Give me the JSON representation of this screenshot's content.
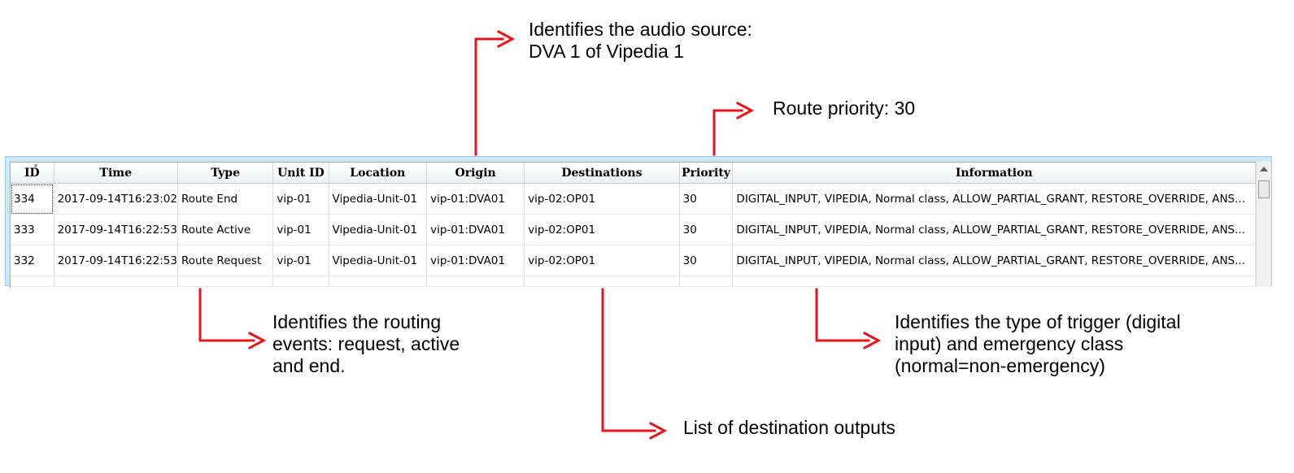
{
  "callouts": {
    "origin": [
      "Identifies the audio source:",
      "DVA 1 of Vipedia 1"
    ],
    "priority": [
      "Route priority: 30"
    ],
    "type": [
      "Identifies the routing",
      "events: request, active",
      "and end."
    ],
    "information": [
      "Identifies the type of trigger (digital",
      "input) and emergency class",
      "(normal=non-emergency)"
    ],
    "destinations": [
      "List of destination outputs"
    ]
  },
  "colors": {
    "arrow": "#e8141c",
    "frame": "#cfe8f7"
  },
  "table": {
    "columns": [
      "ID",
      "Time",
      "Type",
      "Unit ID",
      "Location",
      "Origin",
      "Destinations",
      "Priority",
      "Information"
    ],
    "rows": [
      [
        "334",
        "2017-09-14T16:23:02",
        "Route End",
        "vip-01",
        "Vipedia-Unit-01",
        "vip-01:DVA01",
        "vip-02:OP01",
        "30",
        "DIGITAL_INPUT, VIPEDIA, Normal class, ALLOW_PARTIAL_GRANT, RESTORE_OVERRIDE, ANS..."
      ],
      [
        "333",
        "2017-09-14T16:22:53",
        "Route Active",
        "vip-01",
        "Vipedia-Unit-01",
        "vip-01:DVA01",
        "vip-02:OP01",
        "30",
        "DIGITAL_INPUT, VIPEDIA, Normal class, ALLOW_PARTIAL_GRANT, RESTORE_OVERRIDE, ANS..."
      ],
      [
        "332",
        "2017-09-14T16:22:53",
        "Route Request",
        "vip-01",
        "Vipedia-Unit-01",
        "vip-01:DVA01",
        "vip-02:OP01",
        "30",
        "DIGITAL_INPUT, VIPEDIA, Normal class, ALLOW_PARTIAL_GRANT, RESTORE_OVERRIDE, ANS..."
      ]
    ]
  },
  "scrollbar": {
    "up_icon": "triangle-up-icon"
  }
}
